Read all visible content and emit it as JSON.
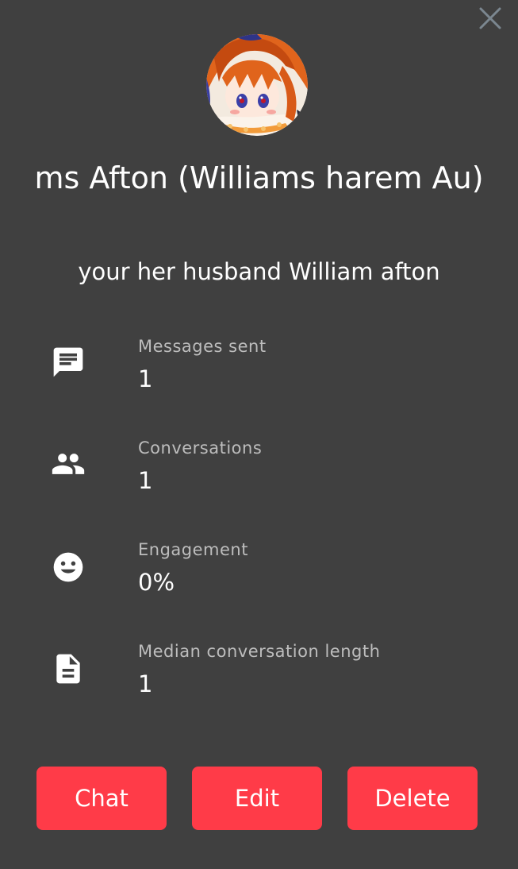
{
  "profile": {
    "name": "ms Afton (Williams harem Au)",
    "description": "your her husband William afton"
  },
  "stats": [
    {
      "icon": "message-icon",
      "label": "Messages sent",
      "value": "1"
    },
    {
      "icon": "people-icon",
      "label": "Conversations",
      "value": "1"
    },
    {
      "icon": "smiley-icon",
      "label": "Engagement",
      "value": "0%"
    },
    {
      "icon": "document-icon",
      "label": "Median conversation length",
      "value": "1"
    }
  ],
  "actions": {
    "chat_label": "Chat",
    "edit_label": "Edit",
    "delete_label": "Delete"
  },
  "colors": {
    "background": "#404040",
    "button": "#ff3b48",
    "label": "#bdbdbd",
    "close": "#7b8790"
  }
}
